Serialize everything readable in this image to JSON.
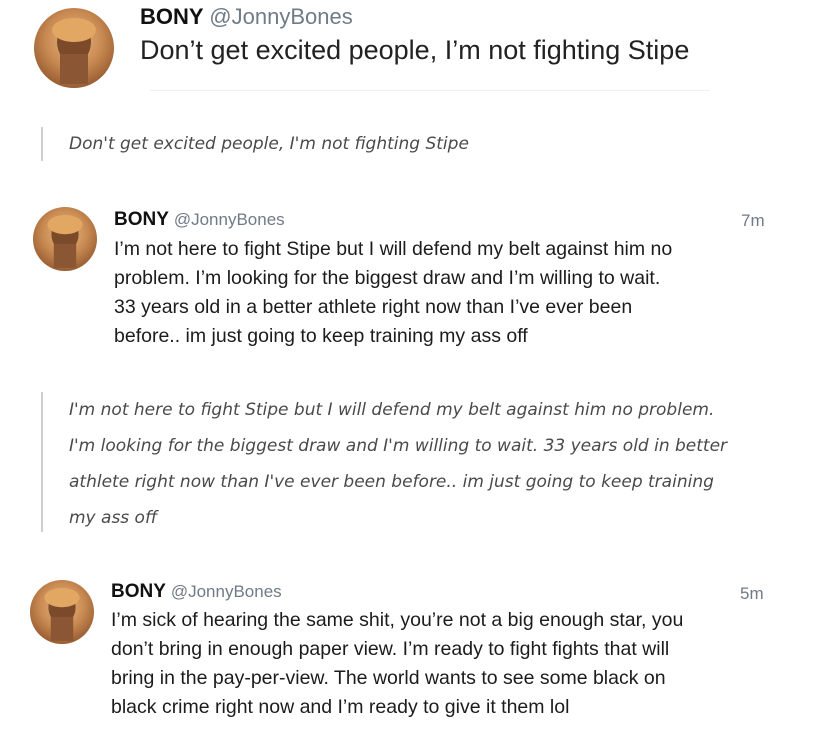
{
  "tweets": [
    {
      "name": "BONY",
      "handle": "@JonnyBones",
      "time": "",
      "text": "Don’t get excited people, I’m not fighting Stipe"
    },
    {
      "name": "BONY",
      "handle": "@JonnyBones",
      "time": "7m",
      "lines": [
        "I’m not here to fight Stipe but I will defend my belt against him no",
        "problem. I’m looking for the biggest draw and I’m willing to wait.",
        "33 years old in a better athlete right now than I’ve ever been",
        "before.. im just going to keep training my ass off"
      ]
    },
    {
      "name": "BONY",
      "handle": "@JonnyBones",
      "time": "5m",
      "lines": [
        "I’m sick of hearing the same shit, you’re not a big enough star, you",
        "don’t bring in enough paper view. I’m ready to fight fights that will",
        "bring in the pay-per-view. The world wants to see some black on",
        "black crime right now and I’m ready to give it them lol"
      ]
    }
  ],
  "quotes": [
    {
      "lines": [
        "Don't get excited people, I'm not fighting Stipe"
      ]
    },
    {
      "lines": [
        "I'm not here to fight Stipe but I will defend my belt against him no problem.",
        "I'm looking for the biggest draw and I'm willing to wait. 33 years old in better",
        "athlete right now than I've ever been before.. im just going to keep training",
        "my ass off"
      ]
    }
  ],
  "icons": {
    "avatar": "profile-photo-icon"
  }
}
